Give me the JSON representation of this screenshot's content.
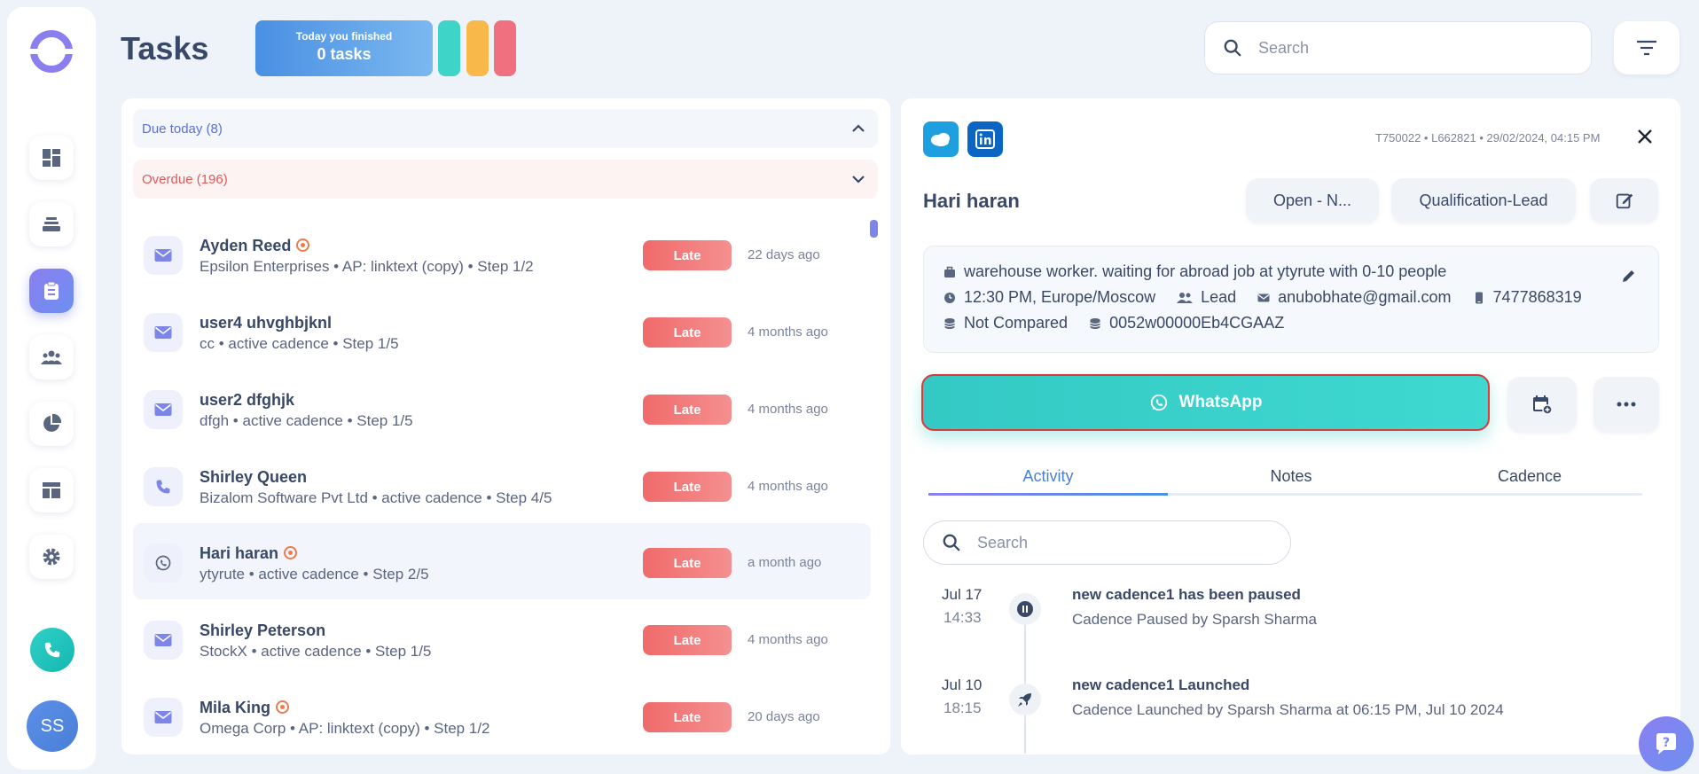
{
  "header": {
    "title": "Tasks",
    "finished_label": "Today you finished",
    "finished_count": "0 tasks",
    "search_placeholder": "Search"
  },
  "colors": {
    "accent": "#8b7ff0",
    "late": "#f06a6a",
    "whatsapp": "#34c9c4",
    "pill_teal": "#3fd4c8",
    "pill_orange": "#f8b84a",
    "pill_pink": "#f07080"
  },
  "sidebar": {
    "avatar_initials": "SS",
    "items": [
      {
        "icon": "dashboard-icon"
      },
      {
        "icon": "stack-icon"
      },
      {
        "icon": "clipboard-icon"
      },
      {
        "icon": "people-icon"
      },
      {
        "icon": "pie-chart-icon"
      },
      {
        "icon": "template-icon"
      },
      {
        "icon": "gear-icon"
      }
    ]
  },
  "groups": {
    "due_today": "Due today (8)",
    "overdue": "Overdue (196)"
  },
  "tasks": [
    {
      "name": "Ayden Reed",
      "hot": true,
      "sub": "Epsilon Enterprises • AP: linktext (copy) • Step 1/2",
      "status": "Late",
      "time": "22 days ago",
      "type": "mail"
    },
    {
      "name": "user4 uhvghbjknl",
      "hot": false,
      "sub": "cc • active cadence • Step 1/5",
      "status": "Late",
      "time": "4 months ago",
      "type": "mail"
    },
    {
      "name": "user2 dfghjk",
      "hot": false,
      "sub": "dfgh • active cadence • Step 1/5",
      "status": "Late",
      "time": "4 months ago",
      "type": "mail"
    },
    {
      "name": "Shirley Queen",
      "hot": false,
      "sub": "Bizalom Software Pvt Ltd • active cadence • Step 4/5",
      "status": "Late",
      "time": "4 months ago",
      "type": "call"
    },
    {
      "name": "Hari haran",
      "hot": true,
      "sub": "ytyrute • active cadence • Step 2/5",
      "status": "Late",
      "time": "a month ago",
      "type": "whatsapp"
    },
    {
      "name": "Shirley Peterson",
      "hot": false,
      "sub": "StockX • active cadence • Step 1/5",
      "status": "Late",
      "time": "4 months ago",
      "type": "mail"
    },
    {
      "name": "Mila King",
      "hot": true,
      "sub": "Omega Corp • AP: linktext (copy) • Step 1/2",
      "status": "Late",
      "time": "20 days ago",
      "type": "mail"
    }
  ],
  "detail": {
    "meta": "T750022 • L662821 • 29/02/2024, 04:15 PM",
    "name": "Hari haran",
    "status_button": "Open - N...",
    "stage_button": "Qualification-Lead",
    "description": "warehouse worker. waiting for abroad job at ytyrute with 0-10 people",
    "timezone": "12:30 PM, Europe/Moscow",
    "type": "Lead",
    "email": "anubobhate@gmail.com",
    "phone": "7477868319",
    "compare": "Not Compared",
    "crm_id": "0052w00000Eb4CGAAZ",
    "action_button": "WhatsApp",
    "tabs": [
      "Activity",
      "Notes",
      "Cadence"
    ],
    "search_placeholder": "Search",
    "activities": [
      {
        "date": "Jul 17",
        "time": "14:33",
        "title": "new cadence1 has been paused",
        "desc": "Cadence Paused by Sparsh Sharma",
        "icon": "pause-icon"
      },
      {
        "date": "Jul 10",
        "time": "18:15",
        "title": "new cadence1 Launched",
        "desc": "Cadence Launched by Sparsh Sharma at 06:15 PM, Jul 10 2024",
        "icon": "rocket-icon"
      }
    ]
  }
}
